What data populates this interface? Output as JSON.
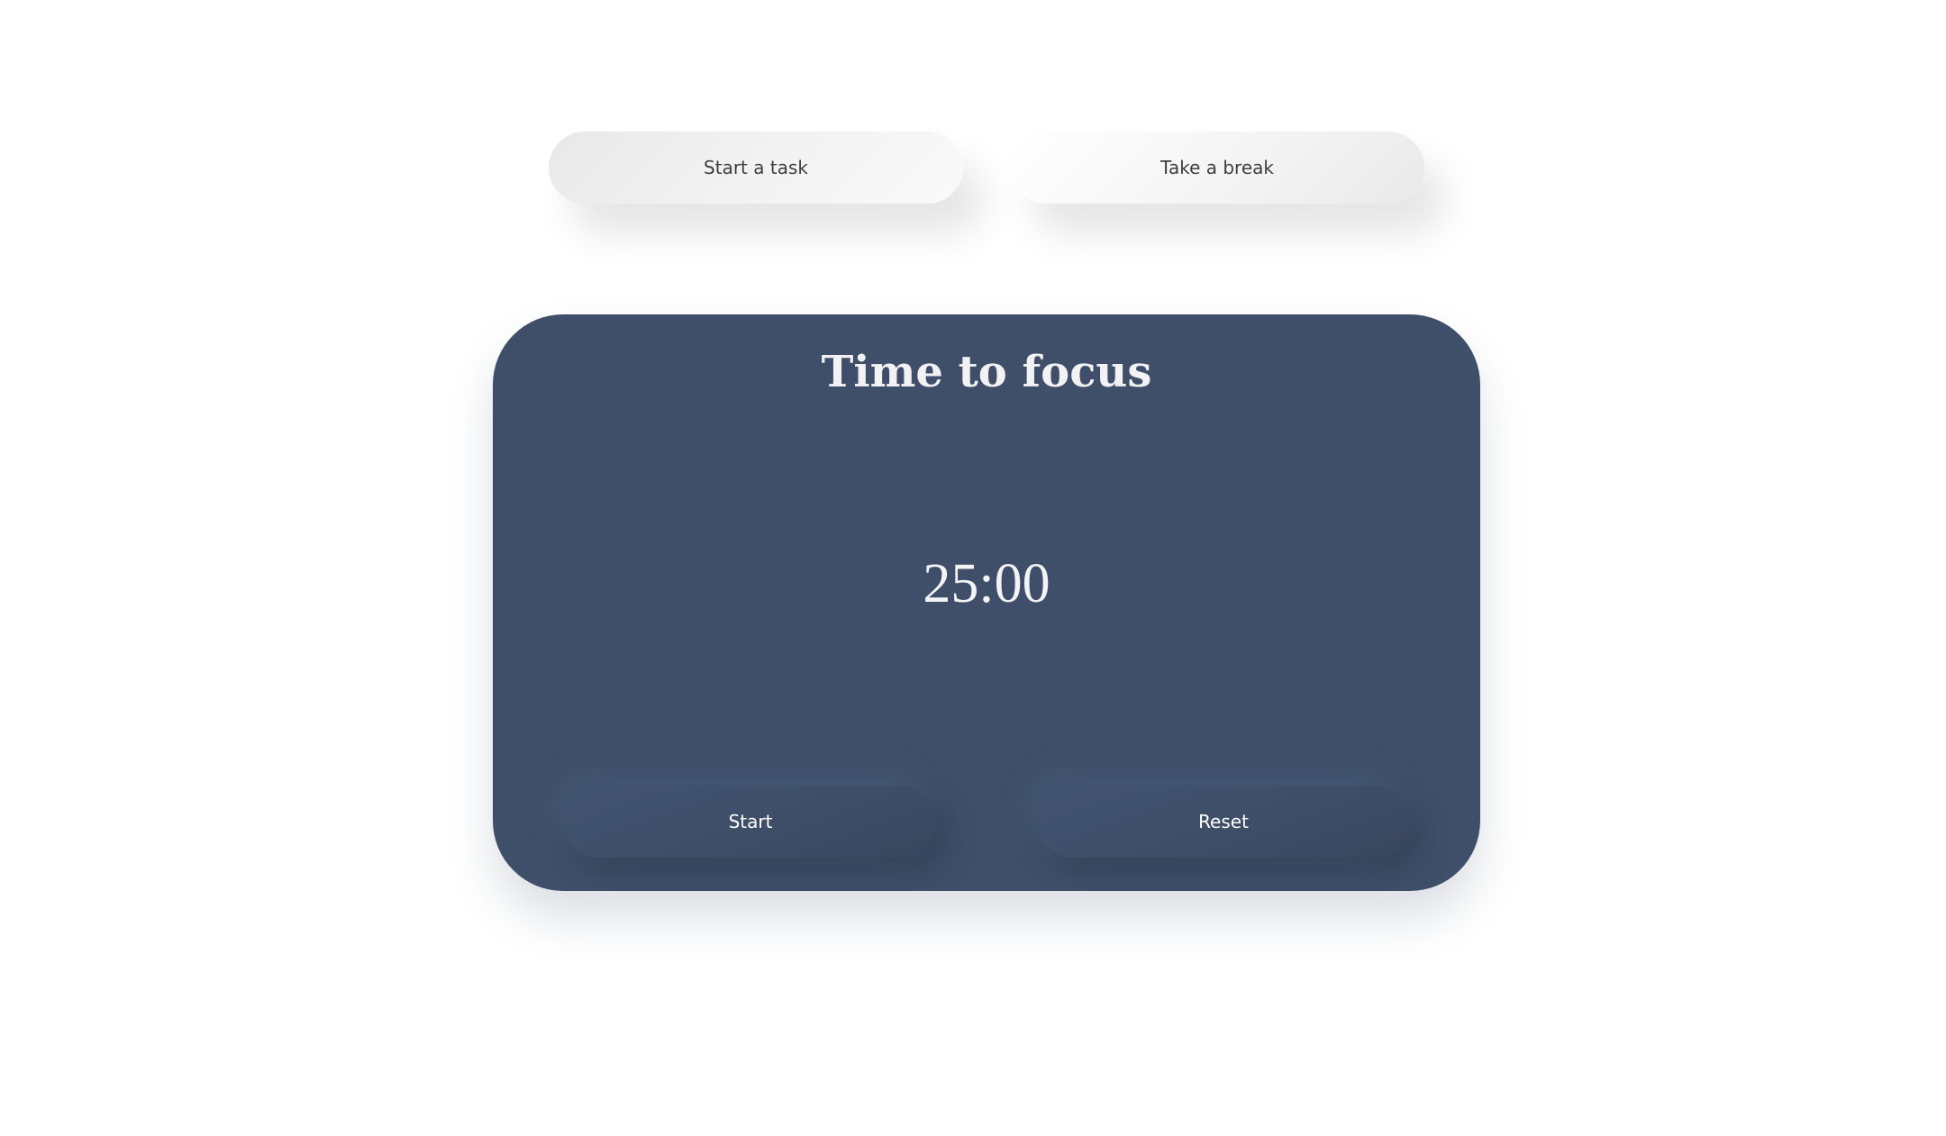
{
  "modes": {
    "task_label": "Start a task",
    "break_label": "Take a break"
  },
  "timer_card": {
    "title": "Time to focus",
    "time": "25:00",
    "start_label": "Start",
    "reset_label": "Reset"
  },
  "colors": {
    "card_background": "#3f4f69",
    "page_background": "#ffffff",
    "mode_button_text": "#3e3e3e"
  }
}
